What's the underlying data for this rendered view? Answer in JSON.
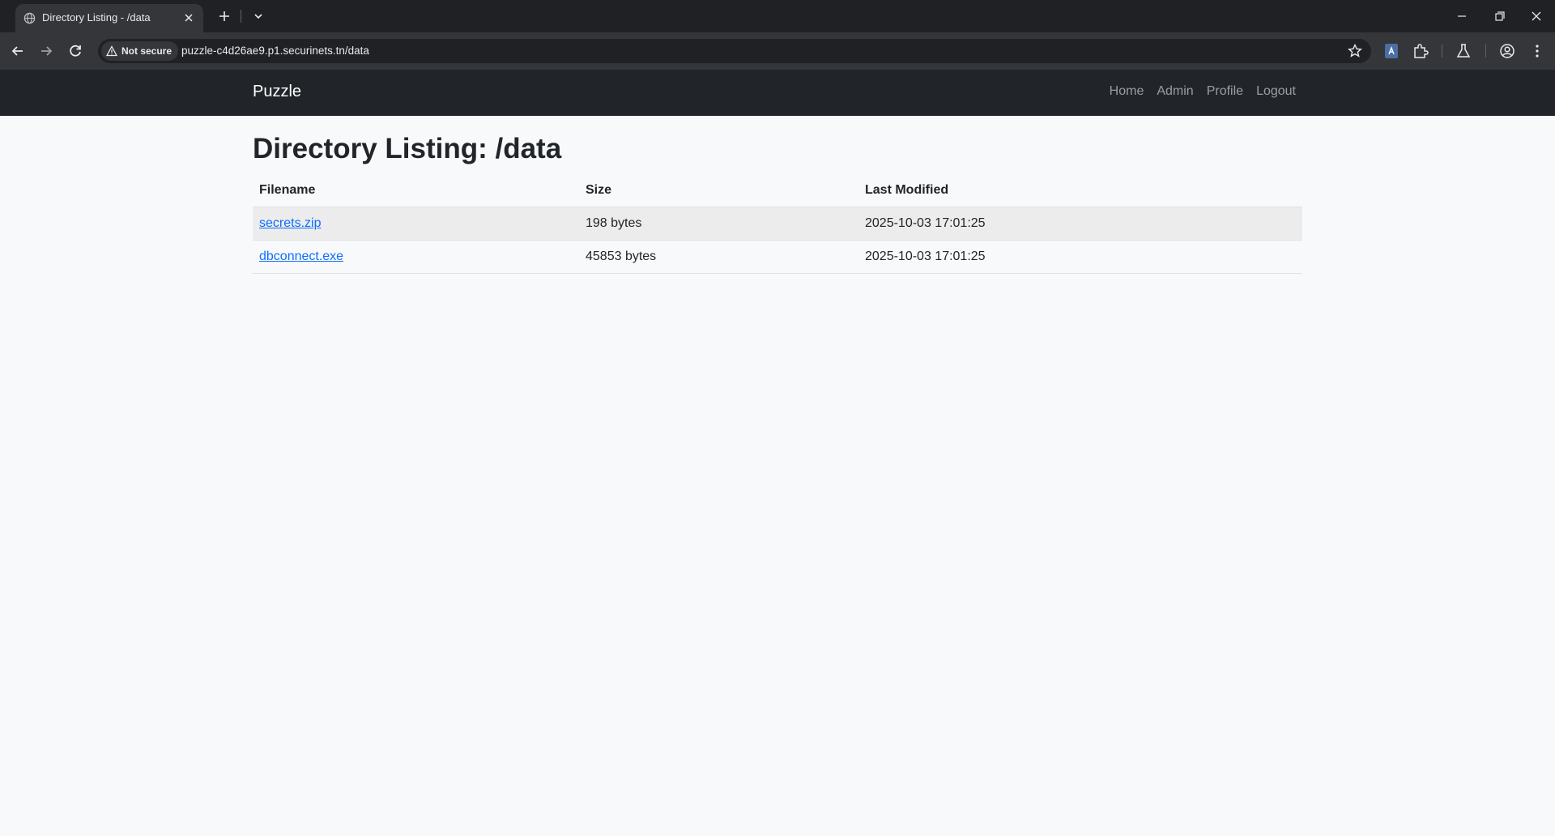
{
  "browser": {
    "tab_title": "Directory Listing - /data",
    "security_label": "Not secure",
    "url": "puzzle-c4d26ae9.p1.securinets.tn/data"
  },
  "navbar": {
    "brand": "Puzzle",
    "links": [
      "Home",
      "Admin",
      "Profile",
      "Logout"
    ]
  },
  "page": {
    "title": "Directory Listing: /data",
    "columns": [
      "Filename",
      "Size",
      "Last Modified"
    ],
    "rows": [
      {
        "filename": "secrets.zip",
        "size": "198 bytes",
        "modified": "2025-10-03 17:01:25"
      },
      {
        "filename": "dbconnect.exe",
        "size": "45853 bytes",
        "modified": "2025-10-03 17:01:25"
      }
    ]
  },
  "colors": {
    "navbar_bg": "#212529",
    "page_bg": "#f8f9fa",
    "link": "#0d6efd",
    "chrome_dark": "#202124",
    "chrome_toolbar": "#35363a"
  },
  "icons": [
    "globe-icon",
    "close-icon",
    "plus-icon",
    "chevron-down-icon",
    "minimize-icon",
    "restore-icon",
    "back-arrow-icon",
    "forward-arrow-icon",
    "reload-icon",
    "warning-icon",
    "star-icon",
    "translate-icon",
    "puzzle-icon",
    "flask-icon",
    "account-icon",
    "kebab-menu-icon"
  ]
}
